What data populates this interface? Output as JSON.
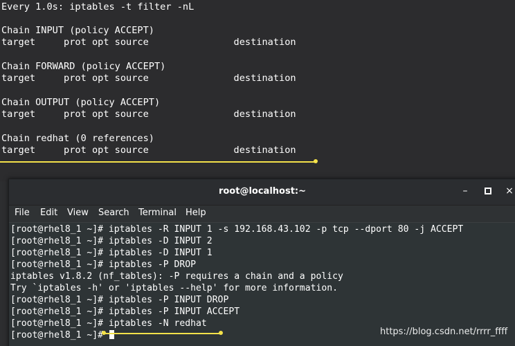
{
  "background_terminal": {
    "lines": [
      "Every 1.0s: iptables -t filter -nL",
      "",
      "Chain INPUT (policy ACCEPT)",
      "target     prot opt source               destination",
      "",
      "Chain FORWARD (policy ACCEPT)",
      "target     prot opt source               destination",
      "",
      "Chain OUTPUT (policy ACCEPT)",
      "target     prot opt source               destination",
      "",
      "Chain redhat (0 references)",
      "target     prot opt source               destination"
    ]
  },
  "window": {
    "title": "root@localhost:~",
    "buttons": {
      "minimize": "–",
      "maximize": "▫",
      "close": "×"
    },
    "menu": [
      "File",
      "Edit",
      "View",
      "Search",
      "Terminal",
      "Help"
    ],
    "lines": [
      "[root@rhel8_1 ~]# iptables -R INPUT 1 -s 192.168.43.102 -p tcp --dport 80 -j ACCEPT",
      "[root@rhel8_1 ~]# iptables -D INPUT 2",
      "[root@rhel8_1 ~]# iptables -D INPUT 1",
      "[root@rhel8_1 ~]# iptables -P DROP",
      "iptables v1.8.2 (nf_tables): -P requires a chain and a policy",
      "Try `iptables -h' or 'iptables --help' for more information.",
      "[root@rhel8_1 ~]# iptables -P INPUT DROP",
      "[root@rhel8_1 ~]# iptables -P INPUT ACCEPT",
      "[root@rhel8_1 ~]# iptables -N redhat",
      "[root@rhel8_1 ~]# "
    ]
  },
  "watermark": "https://blog.csdn.net/rrrr_ffff",
  "colors": {
    "annotation": "#f4e24a",
    "terminal_bg": "#2e3436",
    "text": "#ffffff"
  }
}
